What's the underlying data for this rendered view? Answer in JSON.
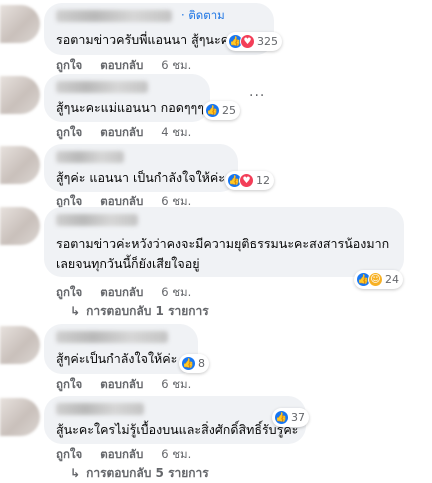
{
  "follow_label": "ติดตาม",
  "follow_dot": "·",
  "comments": [
    {
      "text": "รอตามข่าวครับพี่แอนนา สู้ๆนะครับ",
      "reaction_count": "325",
      "actions": {
        "like": "ถูกใจ",
        "reply": "ตอบกลับ",
        "time": "6 ชม."
      }
    },
    {
      "text": "สู้ๆนะคะแม่แอนนา กอดๆๆๆ",
      "reaction_count": "25",
      "actions": {
        "like": "ถูกใจ",
        "reply": "ตอบกลับ",
        "time": "4 ชม."
      },
      "more": "···"
    },
    {
      "text": "สู้ๆค่ะ แอนนา เป็นกำลังใจให้ค่ะ",
      "reaction_count": "12",
      "actions": {
        "like": "ถูกใจ",
        "reply": "ตอบกลับ",
        "time": "6 ชม."
      }
    },
    {
      "text_line1": "รอตามข่าวค่ะหวังว่าคงจะมีความยุติธรรมนะคะสงสารน้องมาก",
      "text_line2": "เลยจนทุกวันนี้ก็ยังเสียใจอยู่",
      "reaction_count": "24",
      "actions": {
        "like": "ถูกใจ",
        "reply": "ตอบกลับ",
        "time": "6 ชม."
      },
      "replies_label": "การตอบกลับ 1 รายการ"
    },
    {
      "text": "สู้ๆค่ะเป็นกำลังใจให้ค่ะ",
      "reaction_count": "8",
      "actions": {
        "like": "ถูกใจ",
        "reply": "ตอบกลับ",
        "time": "6 ชม."
      }
    },
    {
      "text": "สู้นะคะใครไม่รู้เบื้องบนและสิ่งศักดิ์สิทธิ์รับรู้ค่ะ",
      "reaction_count": "37",
      "actions": {
        "like": "ถูกใจ",
        "reply": "ตอบกลับ",
        "time": "6 ชม."
      },
      "replies_label": "การตอบกลับ 5 รายการ"
    }
  ],
  "icons": {
    "like": "like-icon",
    "love": "love-icon",
    "care": "care-icon",
    "reply_arrow": "reply-arrow-icon"
  },
  "colors": {
    "bubble": "#f0f2f5",
    "like": "#1877f2",
    "love": "#f33e58",
    "link": "#1b74e4",
    "meta": "#65676b"
  }
}
